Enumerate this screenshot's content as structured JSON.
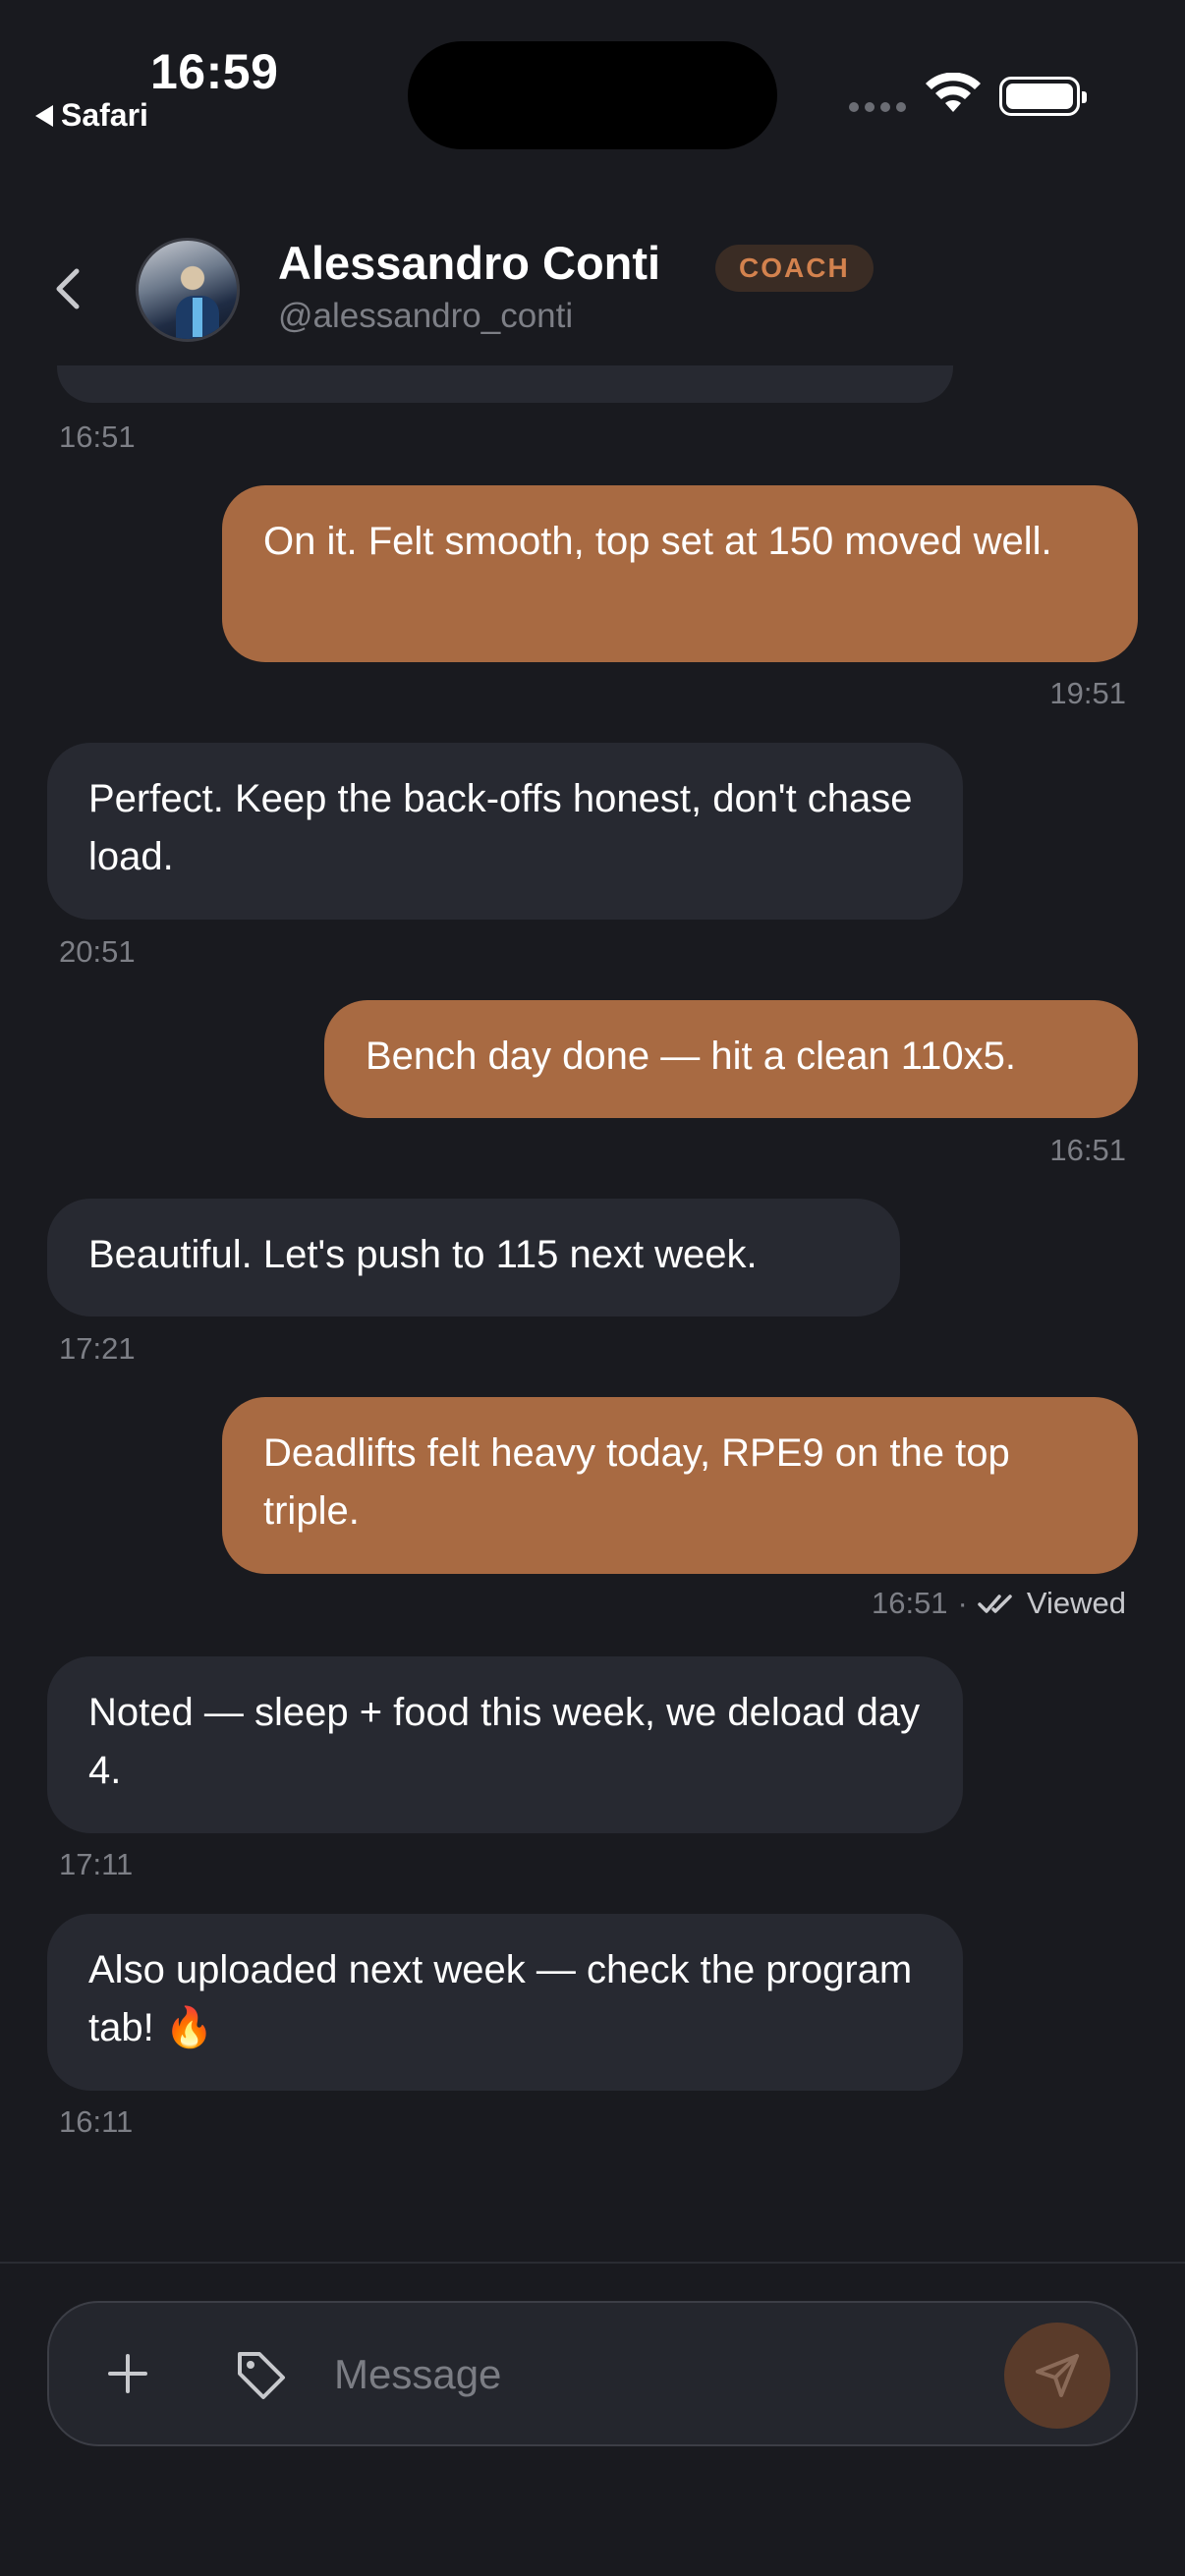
{
  "status_bar": {
    "time": "16:59",
    "back_app": "Safari"
  },
  "header": {
    "name": "Alessandro Conti",
    "badge": "COACH",
    "handle": "@alessandro_conti"
  },
  "messages": [
    {
      "id": "m0",
      "direction": "in",
      "text": "",
      "time": "16:51"
    },
    {
      "id": "m1",
      "direction": "out",
      "text": "On it. Felt smooth, top set at 150 moved well.",
      "time": "19:51"
    },
    {
      "id": "m2",
      "direction": "in",
      "text": "Perfect. Keep the back-offs honest, don't chase load.",
      "time": "20:51"
    },
    {
      "id": "m3",
      "direction": "out",
      "text": "Bench day done — hit a clean 110x5.",
      "time": "16:51"
    },
    {
      "id": "m4",
      "direction": "in",
      "text": "Beautiful. Let's push to 115 next week.",
      "time": "17:21"
    },
    {
      "id": "m5",
      "direction": "out",
      "text": "Deadlifts felt heavy today, RPE9 on the top triple.",
      "time": "16:51",
      "status": "Viewed",
      "separator": "·"
    },
    {
      "id": "m6",
      "direction": "in",
      "text": "Noted — sleep + food this week, we deload day 4.",
      "time": "17:11"
    },
    {
      "id": "m7",
      "direction": "in",
      "text": "Also uploaded next week — check the program tab! 🔥",
      "time": "16:11"
    }
  ],
  "composer": {
    "placeholder": "Message",
    "icons": [
      "plus-icon",
      "tag-icon",
      "send-icon"
    ]
  },
  "colors": {
    "background": "#191a1f",
    "outgoing_bubble": "#a86a42",
    "incoming_bubble": "#272931",
    "accent": "#d3824e"
  }
}
